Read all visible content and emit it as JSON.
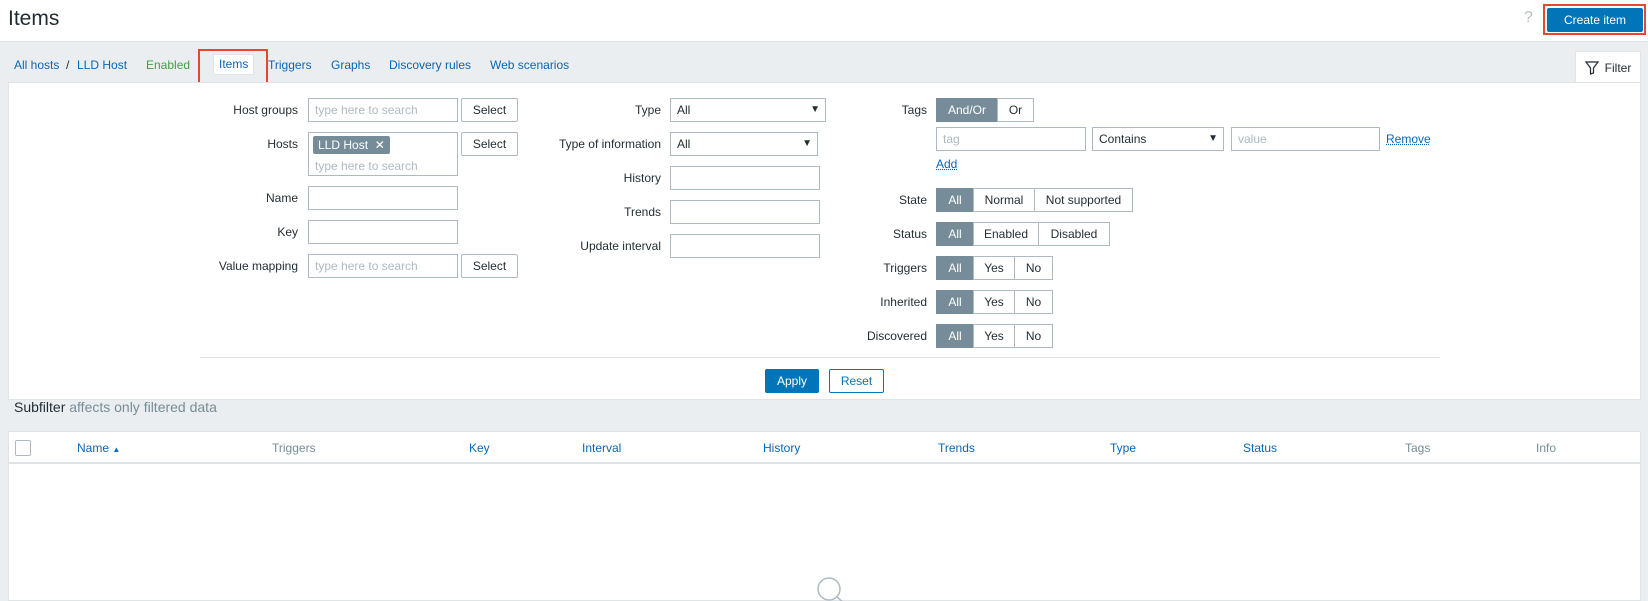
{
  "header": {
    "title": "Items",
    "help": "?",
    "create_label": "Create item"
  },
  "breadcrumbs": {
    "all_hosts": "All hosts",
    "sep": "/",
    "host": "LLD Host",
    "enabled": "Enabled",
    "tabs": [
      "Items",
      "Triggers",
      "Graphs",
      "Discovery rules",
      "Web scenarios"
    ]
  },
  "filter": {
    "tab_label": "Filter",
    "host_groups": {
      "label": "Host groups",
      "placeholder": "type here to search",
      "select": "Select"
    },
    "hosts": {
      "label": "Hosts",
      "chip": "LLD Host",
      "placeholder": "type here to search",
      "select": "Select"
    },
    "name": {
      "label": "Name",
      "value": ""
    },
    "key": {
      "label": "Key",
      "value": ""
    },
    "value_mapping": {
      "label": "Value mapping",
      "placeholder": "type here to search",
      "select": "Select"
    },
    "type": {
      "label": "Type",
      "value": "All"
    },
    "type_info": {
      "label": "Type of information",
      "value": "All"
    },
    "history": {
      "label": "History",
      "value": ""
    },
    "trends": {
      "label": "Trends",
      "value": ""
    },
    "update_interval": {
      "label": "Update interval",
      "value": ""
    },
    "tags": {
      "label": "Tags",
      "options": [
        "And/Or",
        "Or"
      ],
      "tag_placeholder": "tag",
      "operator": "Contains",
      "value_placeholder": "value",
      "remove": "Remove",
      "add": "Add"
    },
    "state": {
      "label": "State",
      "options": [
        "All",
        "Normal",
        "Not supported"
      ]
    },
    "status": {
      "label": "Status",
      "options": [
        "All",
        "Enabled",
        "Disabled"
      ]
    },
    "triggers": {
      "label": "Triggers",
      "options": [
        "All",
        "Yes",
        "No"
      ]
    },
    "inherited": {
      "label": "Inherited",
      "options": [
        "All",
        "Yes",
        "No"
      ]
    },
    "discovered": {
      "label": "Discovered",
      "options": [
        "All",
        "Yes",
        "No"
      ]
    },
    "apply": "Apply",
    "reset": "Reset"
  },
  "subfilter": {
    "title": "Subfilter",
    "note": "affects only filtered data"
  },
  "table": {
    "columns": [
      "Name",
      "Triggers",
      "Key",
      "Interval",
      "History",
      "Trends",
      "Type",
      "Status",
      "Tags",
      "Info"
    ],
    "sort_indicator": "▲"
  },
  "colors": {
    "accent": "#0275b8",
    "highlight": "#e8472f",
    "enabled": "#429e47",
    "segment_on": "#768d99"
  }
}
